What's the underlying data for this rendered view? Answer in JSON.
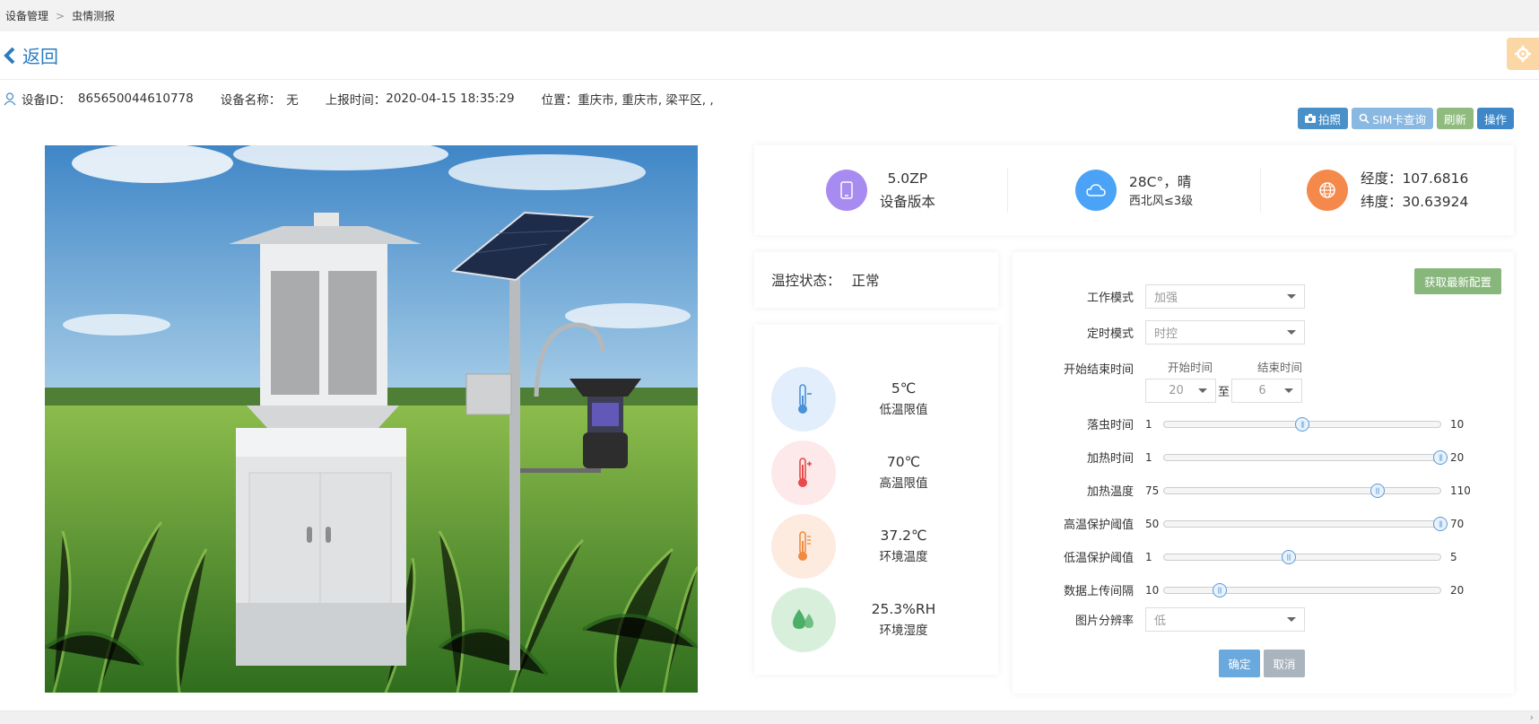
{
  "breadcrumb": {
    "items": [
      "设备管理",
      "虫情测报"
    ],
    "separator": ">"
  },
  "back": {
    "label": "返回"
  },
  "info": {
    "device_id_label": "设备ID：",
    "device_id": "865650044610778",
    "device_name_label": "设备名称：",
    "device_name": "无",
    "report_time_label": "上报时间：",
    "report_time": "2020-04-15 18:35:29",
    "location_label": "位置：",
    "location": "重庆市, 重庆市, 梁平区, ,"
  },
  "actions": {
    "photo": "拍照",
    "sim": "SIM卡查询",
    "refresh": "刷新",
    "operate": "操作"
  },
  "stats": {
    "version_value": "5.0ZP",
    "version_label": "设备版本",
    "weather_value": "28C°，晴",
    "weather_wind": "西北风≤3级",
    "longitude": "经度：107.6816",
    "latitude": "纬度：30.63924"
  },
  "temp_status": {
    "label": "温控状态：",
    "value": "正常"
  },
  "sensors": [
    {
      "value": "5℃",
      "label": "低温限值"
    },
    {
      "value": "70℃",
      "label": "高温限值"
    },
    {
      "value": "37.2℃",
      "label": "环境温度"
    },
    {
      "value": "25.3%RH",
      "label": "环境湿度"
    }
  ],
  "config": {
    "fetch_button": "获取最新配置",
    "work_mode": {
      "label": "工作模式",
      "value": "加强"
    },
    "timer_mode": {
      "label": "定时模式",
      "value": "时控"
    },
    "start_end": {
      "label": "开始结束时间",
      "start_label": "开始时间",
      "end_label": "结束时间",
      "start_value": "20",
      "end_value": "6",
      "to": "至"
    },
    "sliders": [
      {
        "label": "落虫时间",
        "min": "1",
        "max": "10",
        "value": 5.5
      },
      {
        "label": "加热时间",
        "min": "1",
        "max": "20",
        "value": 20
      },
      {
        "label": "加热温度",
        "min": "75",
        "max": "110",
        "value": 102
      },
      {
        "label": "高温保护阈值",
        "min": "50",
        "max": "70",
        "value": 70
      },
      {
        "label": "低温保护阈值",
        "min": "1",
        "max": "5",
        "value": 2.8
      },
      {
        "label": "数据上传间隔",
        "min": "10",
        "max": "20",
        "value": 12
      }
    ],
    "resolution": {
      "label": "图片分辨率",
      "value": "低"
    },
    "ok": "确定",
    "cancel": "取消"
  },
  "colors": {
    "accent": "#2b7cc1",
    "version_circle": "#a78bf0",
    "weather_circle": "#4aa3f7",
    "location_circle": "#f5894c"
  }
}
